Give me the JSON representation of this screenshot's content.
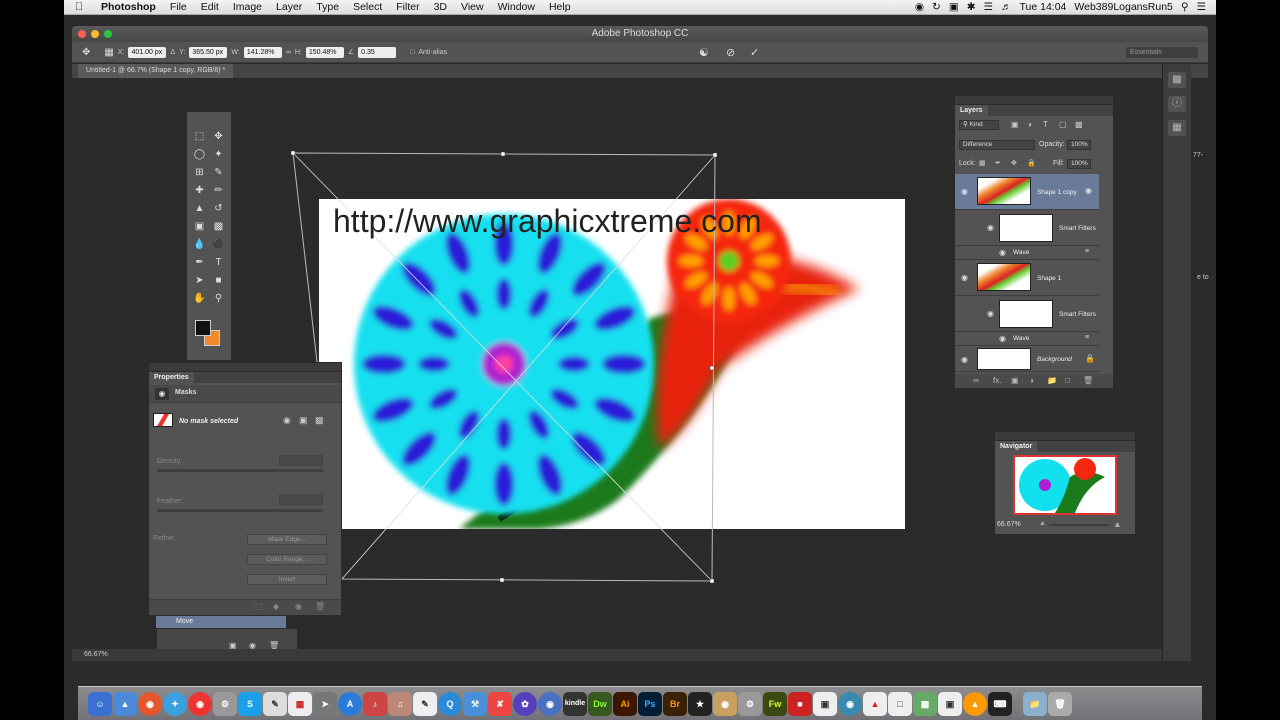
{
  "menubar": {
    "app_name": "Photoshop",
    "items": [
      "File",
      "Edit",
      "Image",
      "Layer",
      "Type",
      "Select",
      "Filter",
      "3D",
      "View",
      "Window",
      "Help"
    ],
    "clock": "Tue 14:04",
    "user": "Web389LogansRun5"
  },
  "window": {
    "title": "Adobe Photoshop CC"
  },
  "options": {
    "x_label": "X:",
    "x_value": "401.00 px",
    "y_label": "Y:",
    "y_value": "365.50 px",
    "w_label": "W:",
    "w_value": "141.28%",
    "h_label": "H:",
    "h_value": "150.48%",
    "angle_value": "0.35",
    "antialias_label": "Anti-alias",
    "workspace": "Essentials"
  },
  "document": {
    "tab_label": "Untitled-1 @ 66.7% (Shape 1 copy, RGB/8) *",
    "canvas_text": "http://www.graphicxtreme.com",
    "zoom": "66.67%"
  },
  "properties": {
    "title": "Properties",
    "section": "Masks",
    "status": "No mask selected",
    "density_label": "Density:",
    "feather_label": "Feather:",
    "refine_label": "Refine:",
    "mask_edge_button": "Mask Edge...",
    "color_range_button": "Color Range...",
    "invert_button": "Invert",
    "move_item": "Move"
  },
  "layers": {
    "title": "Layers",
    "kind_filter": "Kind",
    "blend_mode": "Difference",
    "opacity_label": "Opacity:",
    "opacity_value": "100%",
    "lock_label": "Lock:",
    "fill_label": "Fill:",
    "fill_value": "100%",
    "rows": [
      {
        "name": "Shape 1 copy",
        "smart_filters": "Smart Filters",
        "filter": "Wave"
      },
      {
        "name": "Shape 1",
        "smart_filters": "Smart Filters",
        "filter": "Wave"
      },
      {
        "name": "Background"
      }
    ],
    "footer_fx": "fx."
  },
  "navigator": {
    "title": "Navigator",
    "zoom": "66.67%"
  },
  "side_texts": [
    "77-",
    "e to"
  ],
  "dock_labels": [
    "Dw",
    "Ai",
    "Ps",
    "Br",
    "Fw",
    "kindle"
  ],
  "colors": {
    "foreground": "#111111",
    "background": "#f5892b",
    "selection": "#6a7a99"
  }
}
